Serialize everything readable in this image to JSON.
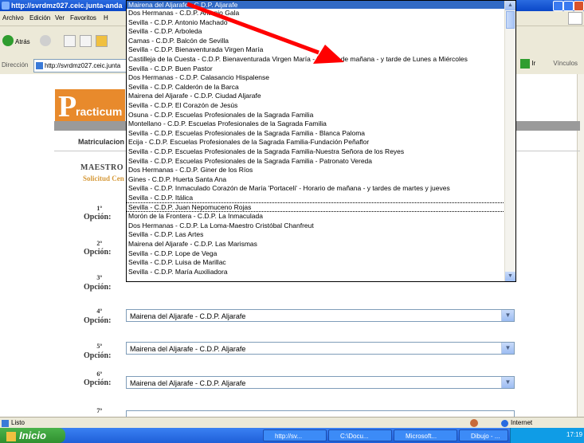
{
  "window": {
    "title": "http://svrdmz027.ceic.junta-anda"
  },
  "menu": [
    "Archivo",
    "Edición",
    "Ver",
    "Favoritos",
    "H"
  ],
  "toolbar": {
    "back_label": "Atrás"
  },
  "addressbar": {
    "label": "Dirección",
    "url": "http://svrdmz027.ceic.junta",
    "go_label": "Ir",
    "links_label": "Vínculos"
  },
  "page": {
    "logo_letter": "P",
    "logo_rest": "racticum",
    "nav_text": "Matriculacion",
    "heading": "MAESTRO E",
    "subheading": "Solicitud Cen"
  },
  "options": [
    {
      "num": "1º",
      "label": "Opción:",
      "value": ""
    },
    {
      "num": "2º",
      "label": "Opción:",
      "value": ""
    },
    {
      "num": "3º",
      "label": "Opción:",
      "value": ""
    },
    {
      "num": "4º",
      "label": "Opción:",
      "value": "Mairena del Aljarafe - C.D.P. Aljarafe"
    },
    {
      "num": "5º",
      "label": "Opción:",
      "value": "Mairena del Aljarafe - C.D.P. Aljarafe"
    },
    {
      "num": "6º",
      "label": "Opción:",
      "value": "Mairena del Aljarafe - C.D.P. Aljarafe"
    },
    {
      "num": "7º",
      "label": "",
      "value": ""
    }
  ],
  "dropdown": {
    "highlighted": "Mairena del Aljarafe - C.D.P. Aljarafe",
    "focused_index": 23,
    "items": [
      "Dos Hermanas - C.D.P. Antonio Gala",
      "Sevilla - C.D.P. Antonio Machado",
      "Sevilla - C.D.P. Arboleda",
      "Camas - C.D.P. Balcón de Sevilla",
      "Sevilla - C.D.P. Bienaventurada Virgen María",
      "Castilleja de la Cuesta - C.D.P. Bienaventurada Virgen María - Horario de mañana - y tarde de Lunes a Miércoles",
      "Sevilla - C.D.P. Buen Pastor",
      "Dos Hermanas - C.D.P. Calasancio Hispalense",
      "Sevilla - C.D.P. Calderón de la Barca",
      "Mairena del Aljarafe - C.D.P. Ciudad Aljarafe",
      "Sevilla - C.D.P. El Corazón de Jesús",
      "Osuna - C.D.P. Escuelas Profesionales de la Sagrada Familia",
      "Montellano - C.D.P. Escuelas Profesionales de la Sagrada Familia",
      "Sevilla - C.D.P. Escuelas Profesionales de la Sagrada Familia - Blanca Paloma",
      "Ecija - C.D.P. Escuelas Profesionales de la Sagrada Familia-Fundación Peñaflor",
      "Sevilla - C.D.P. Escuelas Profesionales de la Sagrada Familia-Nuestra Señora de los Reyes",
      "Sevilla - C.D.P. Escuelas Profesionales de la Sagrada Familia - Patronato Vereda",
      "Dos Hermanas - C.D.P. Giner de los Ríos",
      "Gines - C.D.P. Huerta Santa Ana",
      "Sevilla - C.D.P. Inmaculado Corazón de María 'Portaceli' - Horario de mañana - y tardes de martes y jueves",
      "Sevilla - C.D.P. Itálica",
      "Sevilla - C.D.P. Juan Nepomuceno Rojas",
      "Morón de la Frontera - C.D.P. La Inmaculada",
      "Dos Hermanas - C.D.P. La Loma-Maestro Cristóbal Chanfreut",
      "Sevilla - C.D.P. Las Artes",
      "Mairena del Aljarafe - C.D.P. Las Marismas",
      "Sevilla - C.D.P. Lope de Vega",
      "Sevilla - C.D.P. Luisa de Marillac",
      "Sevilla - C.D.P. María Auxiliadora"
    ]
  },
  "status": {
    "left": "Listo",
    "zone": "Internet"
  },
  "taskbar": {
    "start": "Inicio",
    "items": [
      "http://sv...",
      "C:\\Docu...",
      "Microsoft...",
      "Dibujo - ..."
    ],
    "clock": "17:19"
  },
  "colors": {
    "logo": "#e88a2c",
    "highlight": "#316ac5",
    "arrow": "#ff0000"
  }
}
